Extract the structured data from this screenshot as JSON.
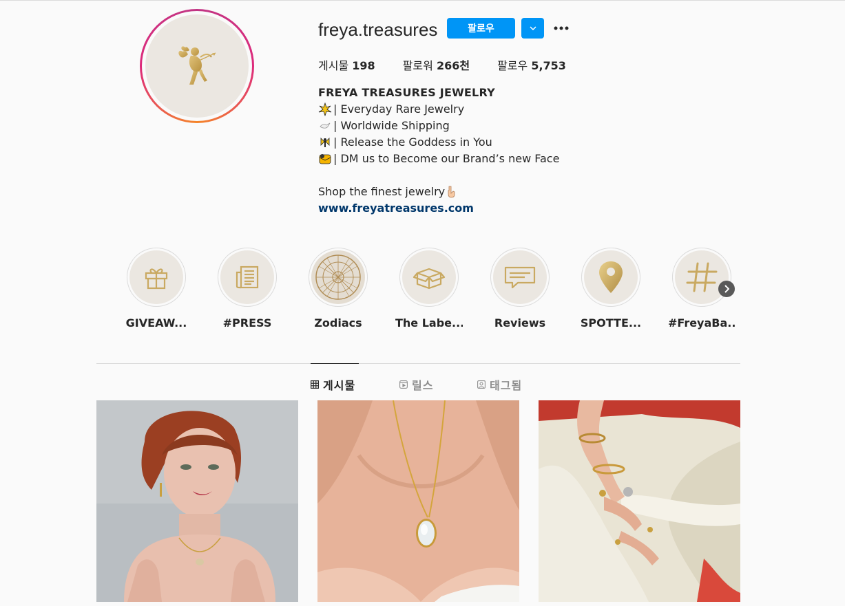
{
  "profile": {
    "username": "freya.treasures",
    "follow_label": "팔로우",
    "avatar_icon": "cupid-icon"
  },
  "stats": {
    "posts_label": "게시물",
    "posts_value": "198",
    "followers_label": "팔로워",
    "followers_value": "266천",
    "following_label": "팔로우",
    "following_value": "5,753"
  },
  "bio": {
    "name": "FREYA TREASURES JEWELRY",
    "lines": [
      {
        "icon": "sparkle-burst-icon",
        "text": "| Everyday Rare Jewelry"
      },
      {
        "icon": "dove-icon",
        "text": "| Worldwide Shipping"
      },
      {
        "icon": "fairy-icon",
        "text": "| Release the Goddess in You"
      },
      {
        "icon": "envelope-icon",
        "text": "| DM us to Become our Brand’s new Face"
      }
    ],
    "shop_text": "Shop the finest jewelry",
    "shop_icon": "pointing-down-icon",
    "link": "www.freyatreasures.com"
  },
  "highlights": [
    {
      "label": "GIVEAW...",
      "icon": "gift-icon"
    },
    {
      "label": "#PRESS",
      "icon": "newspaper-icon"
    },
    {
      "label": "Zodiacs",
      "icon": "zodiac-wheel-icon"
    },
    {
      "label": "The Labe...",
      "icon": "box-icon"
    },
    {
      "label": "Reviews",
      "icon": "message-icon"
    },
    {
      "label": "SPOTTE...",
      "icon": "location-pin-icon"
    },
    {
      "label": "#FreyaBa...",
      "icon": "hashtag-icon"
    }
  ],
  "tabs": [
    {
      "label": "게시물",
      "icon": "grid-icon",
      "active": true
    },
    {
      "label": "릴스",
      "icon": "reels-icon",
      "active": false
    },
    {
      "label": "태그됨",
      "icon": "tagged-icon",
      "active": false
    }
  ],
  "colors": {
    "primary": "#0095f6",
    "gold": "#c9a961",
    "highlight_bg": "#ebe7e1",
    "link": "#00376b"
  }
}
